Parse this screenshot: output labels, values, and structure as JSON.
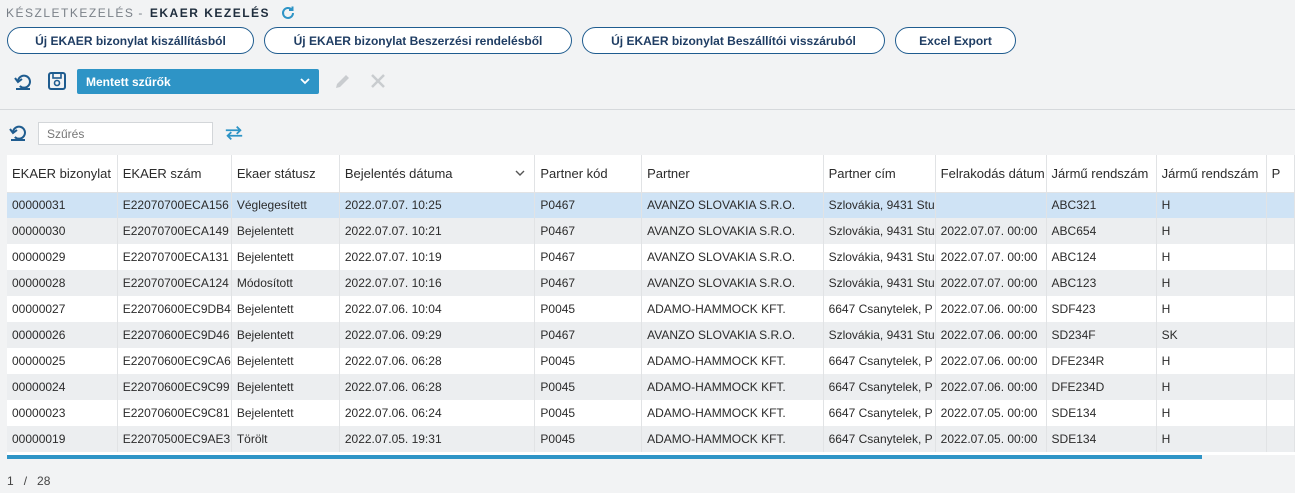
{
  "breadcrumb": {
    "parent": "KÉSZLETKEZELÉS",
    "separator": "-",
    "current": "EKAER KEZELÉS"
  },
  "buttons": {
    "from_delivery": "Új EKAER bizonylat kiszállításból",
    "from_purchase_order": "Új EKAER bizonylat Beszerzési rendelésből",
    "from_supplier_return": "Új EKAER bizonylat Beszállítói visszáruból",
    "excel_export": "Excel Export"
  },
  "toolbar": {
    "saved_filters_label": "Mentett szűrők"
  },
  "filter": {
    "placeholder": "Szűrés"
  },
  "table": {
    "columns": [
      "EKAER bizonylat",
      "EKAER szám",
      "Ekaer státusz",
      "Bejelentés dátuma",
      "Partner kód",
      "Partner",
      "Partner cím",
      "Felrakodás dátum",
      "Jármű rendszám",
      "Jármű rendszám",
      "P"
    ],
    "rows": [
      [
        "00000031",
        "E22070700ECA156",
        "Véglegesített",
        "2022.07.07. 10:25",
        "P0467",
        "AVANZO SLOVAKIA S.R.O.",
        "Szlovákia, 9431 Stu",
        "",
        "ABC321",
        "H",
        ""
      ],
      [
        "00000030",
        "E22070700ECA149",
        "Bejelentett",
        "2022.07.07. 10:21",
        "P0467",
        "AVANZO SLOVAKIA S.R.O.",
        "Szlovákia, 9431 Stu",
        "2022.07.07. 00:00",
        "ABC654",
        "H",
        ""
      ],
      [
        "00000029",
        "E22070700ECA131",
        "Bejelentett",
        "2022.07.07. 10:19",
        "P0467",
        "AVANZO SLOVAKIA S.R.O.",
        "Szlovákia, 9431 Stu",
        "2022.07.07. 00:00",
        "ABC124",
        "H",
        ""
      ],
      [
        "00000028",
        "E22070700ECA124",
        "Módosított",
        "2022.07.07. 10:16",
        "P0467",
        "AVANZO SLOVAKIA S.R.O.",
        "Szlovákia, 9431 Stu",
        "2022.07.07. 00:00",
        "ABC123",
        "H",
        ""
      ],
      [
        "00000027",
        "E22070600EC9DB4",
        "Bejelentett",
        "2022.07.06. 10:04",
        "P0045",
        "ADAMO-HAMMOCK KFT.",
        "6647 Csanytelek, P",
        "2022.07.06. 00:00",
        "SDF423",
        "H",
        ""
      ],
      [
        "00000026",
        "E22070600EC9D46",
        "Bejelentett",
        "2022.07.06. 09:29",
        "P0467",
        "AVANZO SLOVAKIA S.R.O.",
        "Szlovákia, 9431 Stu",
        "2022.07.06. 00:00",
        "SD234F",
        "SK",
        ""
      ],
      [
        "00000025",
        "E22070600EC9CA6",
        "Bejelentett",
        "2022.07.06. 06:28",
        "P0045",
        "ADAMO-HAMMOCK KFT.",
        "6647 Csanytelek, P",
        "2022.07.06. 00:00",
        "DFE234R",
        "H",
        ""
      ],
      [
        "00000024",
        "E22070600EC9C99",
        "Bejelentett",
        "2022.07.06. 06:28",
        "P0045",
        "ADAMO-HAMMOCK KFT.",
        "6647 Csanytelek, P",
        "2022.07.06. 00:00",
        "DFE234D",
        "H",
        ""
      ],
      [
        "00000023",
        "E22070600EC9C81",
        "Bejelentett",
        "2022.07.06. 06:24",
        "P0045",
        "ADAMO-HAMMOCK KFT.",
        "6647 Csanytelek, P",
        "2022.07.05. 00:00",
        "SDE134",
        "H",
        ""
      ],
      [
        "00000019",
        "E22070500EC9AE3",
        "Törölt",
        "2022.07.05. 19:31",
        "P0045",
        "ADAMO-HAMMOCK KFT.",
        "6647 Csanytelek, P",
        "2022.07.05. 00:00",
        "SDE134",
        "H",
        ""
      ]
    ]
  },
  "pager": {
    "page": "1",
    "separator": "/",
    "total": "28"
  },
  "colors": {
    "accent": "#2e94c6",
    "button_border": "#1f5c8f",
    "selected_row": "#cfe3f5",
    "stripe_row": "#eceef0"
  }
}
